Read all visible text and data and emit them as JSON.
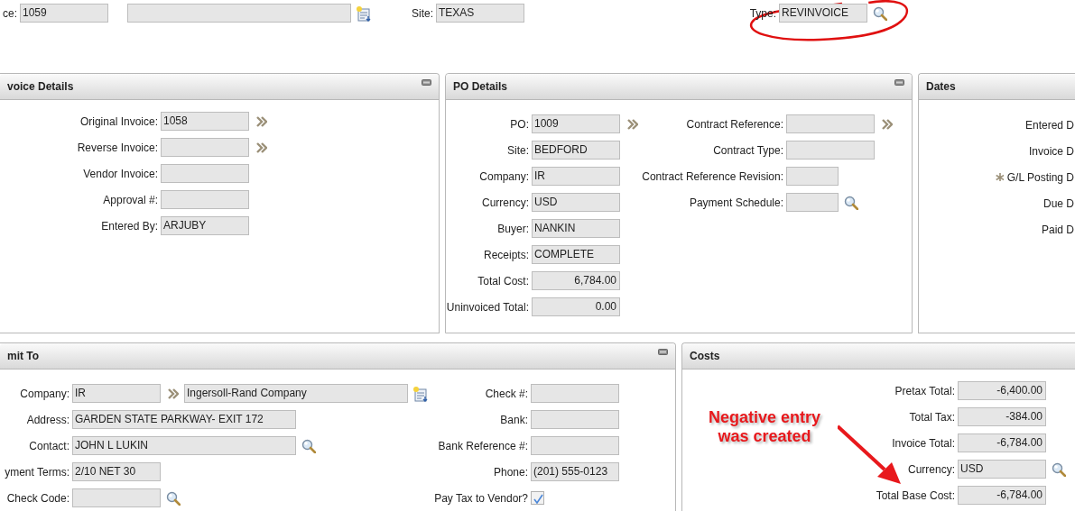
{
  "top_bar": [
    {
      "label": "ce:",
      "highlighted": false,
      "parts": [
        {
          "kind": "field",
          "value": "1059"
        }
      ]
    },
    {
      "highlighted": false,
      "parts": [
        {
          "kind": "field"
        },
        {
          "kind": "new"
        }
      ]
    },
    {
      "label": "Site:",
      "highlighted": false,
      "parts": [
        {
          "kind": "field",
          "value": "TEXAS"
        }
      ]
    },
    {
      "label": "Type:",
      "highlighted": true,
      "parts": [
        {
          "kind": "field",
          "value": "REVINVOICE"
        },
        {
          "kind": "lookup"
        }
      ]
    }
  ],
  "panel_rows": [
    [
      {
        "title": "voice Details",
        "collapsible": true,
        "columns": [
          [
            {
              "label": "Original Invoice:",
              "parts": [
                {
                  "kind": "field",
                  "value": "1058"
                },
                {
                  "kind": "chevron"
                }
              ]
            },
            {
              "label": "Reverse Invoice:",
              "parts": [
                {
                  "kind": "field"
                },
                {
                  "kind": "chevron"
                }
              ]
            },
            {
              "label": "Vendor Invoice:",
              "parts": [
                {
                  "kind": "field"
                }
              ]
            },
            {
              "label": "Approval #:",
              "parts": [
                {
                  "kind": "field"
                }
              ]
            },
            {
              "label": "Entered By:",
              "parts": [
                {
                  "kind": "field",
                  "value": "ARJUBY"
                }
              ]
            }
          ]
        ]
      },
      {
        "title": "PO Details",
        "collapsible": true,
        "columns": [
          [
            {
              "label": "PO:",
              "parts": [
                {
                  "kind": "field",
                  "value": "1009"
                },
                {
                  "kind": "chevron"
                }
              ]
            },
            {
              "label": "Site:",
              "parts": [
                {
                  "kind": "field",
                  "value": "BEDFORD"
                }
              ]
            },
            {
              "label": "Company:",
              "parts": [
                {
                  "kind": "field",
                  "value": "IR"
                }
              ]
            },
            {
              "label": "Currency:",
              "parts": [
                {
                  "kind": "field",
                  "value": "USD"
                }
              ]
            },
            {
              "label": "Buyer:",
              "parts": [
                {
                  "kind": "field",
                  "value": "NANKIN"
                }
              ]
            },
            {
              "label": "Receipts:",
              "parts": [
                {
                  "kind": "field",
                  "value": "COMPLETE"
                }
              ]
            },
            {
              "label": "Total Cost:",
              "parts": [
                {
                  "kind": "field",
                  "value": "6,784.00"
                }
              ]
            },
            {
              "label": "Uninvoiced Total:",
              "parts": [
                {
                  "kind": "field",
                  "value": "0.00"
                }
              ]
            }
          ],
          [
            {
              "label": "Contract Reference:",
              "parts": [
                {
                  "kind": "field"
                },
                {
                  "kind": "chevron"
                }
              ]
            },
            {
              "label": "Contract Type:",
              "parts": [
                {
                  "kind": "field"
                }
              ]
            },
            {
              "label": "Contract Reference Revision:",
              "parts": [
                {
                  "kind": "field"
                }
              ]
            },
            {
              "label": "Payment Schedule:",
              "parts": [
                {
                  "kind": "field"
                },
                {
                  "kind": "lookup"
                }
              ]
            }
          ]
        ]
      },
      {
        "title": "Dates",
        "collapsible": false,
        "columns": [
          [
            {
              "label": "Entered D",
              "required": false
            },
            {
              "label": "Invoice D",
              "required": false
            },
            {
              "label": "G/L Posting D",
              "required": true
            },
            {
              "label": "Due D",
              "required": false
            },
            {
              "label": "Paid D",
              "required": false
            }
          ]
        ]
      }
    ],
    [
      {
        "title": "mit To",
        "collapsible": true,
        "columns": [
          [
            {
              "label": "Company:",
              "parts": [
                {
                  "kind": "field",
                  "value": "IR"
                },
                {
                  "kind": "chevron"
                },
                {
                  "kind": "field",
                  "value": "Ingersoll-Rand Company"
                },
                {
                  "kind": "new"
                }
              ]
            },
            {
              "label": "Address:",
              "parts": [
                {
                  "kind": "field",
                  "value": "GARDEN STATE PARKWAY- EXIT 172"
                }
              ]
            },
            {
              "label": "Contact:",
              "parts": [
                {
                  "kind": "field",
                  "value": "JOHN L LUKIN"
                },
                {
                  "kind": "lookup"
                }
              ]
            },
            {
              "label": "yment Terms:",
              "parts": [
                {
                  "kind": "field",
                  "value": "2/10 NET 30"
                }
              ]
            },
            {
              "label": "Check Code:",
              "parts": [
                {
                  "kind": "field"
                },
                {
                  "kind": "lookup"
                }
              ]
            }
          ],
          [
            {
              "label": "Check #:",
              "parts": [
                {
                  "kind": "field"
                }
              ]
            },
            {
              "label": "Bank:",
              "parts": [
                {
                  "kind": "field"
                }
              ]
            },
            {
              "label": "Bank Reference #:",
              "parts": [
                {
                  "kind": "field"
                }
              ]
            },
            {
              "label": "Phone:",
              "parts": [
                {
                  "kind": "field",
                  "value": "(201) 555-0123"
                }
              ]
            },
            {
              "label": "Pay Tax to Vendor?",
              "parts": [
                {
                  "kind": "checkbox",
                  "checked": true
                }
              ]
            }
          ]
        ]
      },
      {
        "title": "Costs",
        "collapsible": false,
        "annotation": {
          "text": "Negative entry was created"
        },
        "columns": [
          [
            {
              "label": "Pretax Total:",
              "parts": [
                {
                  "kind": "field",
                  "value": "-6,400.00"
                }
              ]
            },
            {
              "label": "Total Tax:",
              "parts": [
                {
                  "kind": "field",
                  "value": "-384.00"
                }
              ]
            },
            {
              "label": "Invoice Total:",
              "parts": [
                {
                  "kind": "field",
                  "value": "-6,784.00"
                }
              ]
            },
            {
              "label": "Currency:",
              "parts": [
                {
                  "kind": "field",
                  "value": "USD"
                },
                {
                  "kind": "lookup"
                }
              ]
            },
            {
              "label": "Total Base Cost:",
              "parts": [
                {
                  "kind": "field",
                  "value": "-6,784.00"
                }
              ]
            }
          ]
        ]
      }
    ]
  ]
}
